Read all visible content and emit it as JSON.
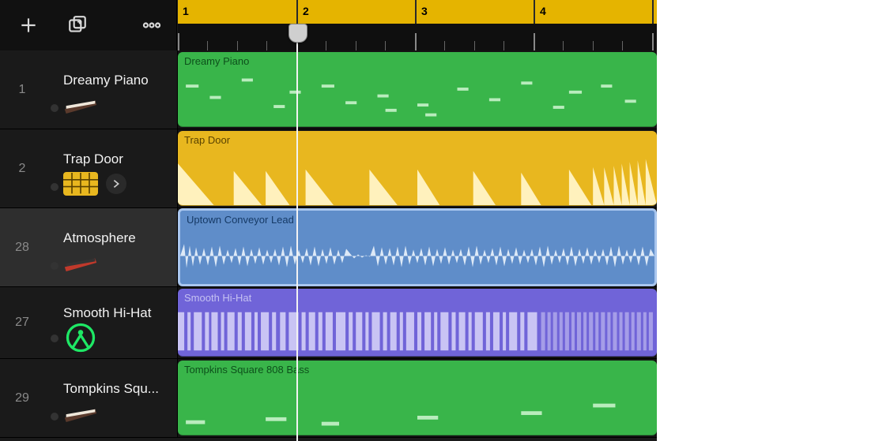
{
  "toolbar": {
    "add_icon": "plus-icon",
    "loop_browser_icon": "add-loop-icon",
    "more_icon": "ellipsis-icon"
  },
  "ruler": {
    "bars": [
      "1",
      "2",
      "3",
      "4"
    ],
    "playhead_bar": 2
  },
  "tracks": [
    {
      "number": "1",
      "name": "Dreamy Piano",
      "icon": "keyboard-piano-icon",
      "selected": false,
      "disclosure": false,
      "region": {
        "label": "Dreamy Piano",
        "color": "green",
        "type": "midi"
      }
    },
    {
      "number": "2",
      "name": "Trap Door",
      "icon": "grid-yellow-icon",
      "selected": false,
      "disclosure": true,
      "region": {
        "label": "Trap Door",
        "color": "yellow",
        "type": "drum"
      }
    },
    {
      "number": "28",
      "name": "Atmosphere",
      "icon": "keyboard-red-icon",
      "selected": true,
      "disclosure": false,
      "region": {
        "label": "Uptown Conveyor Lead",
        "color": "blue",
        "type": "audio",
        "loop_handle": true
      }
    },
    {
      "number": "27",
      "name": "Smooth Hi-Hat",
      "icon": "drum-green-icon",
      "selected": false,
      "disclosure": false,
      "region": {
        "label": "Smooth Hi-Hat",
        "color": "purple",
        "type": "hihat"
      }
    },
    {
      "number": "29",
      "name": "Tompkins Squ...",
      "icon": "keyboard-piano-icon",
      "selected": false,
      "disclosure": false,
      "region": {
        "label": "Tompkins Square 808 Bass",
        "color": "green",
        "type": "bass"
      }
    }
  ]
}
